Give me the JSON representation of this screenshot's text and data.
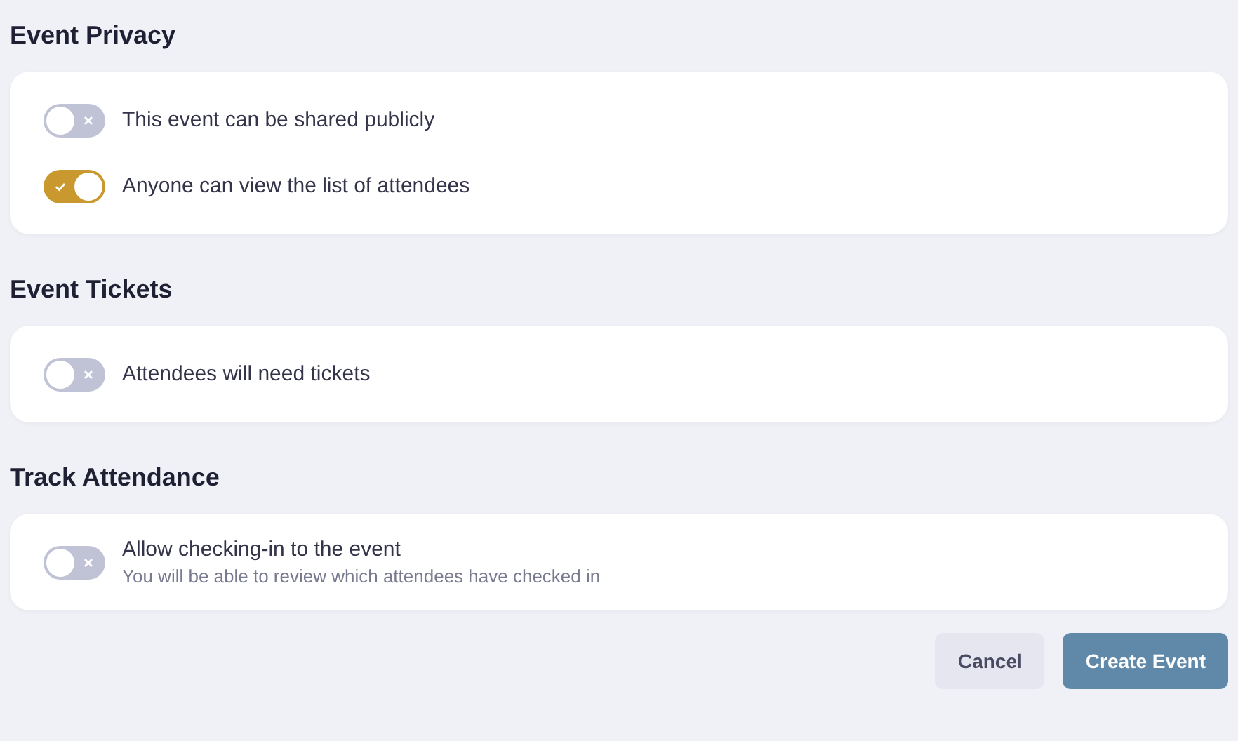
{
  "sections": [
    {
      "title": "Event Privacy",
      "options": [
        {
          "label": "This event can be shared publicly",
          "on": false
        },
        {
          "label": "Anyone can view the list of attendees",
          "on": true
        }
      ]
    },
    {
      "title": "Event Tickets",
      "options": [
        {
          "label": "Attendees will need tickets",
          "on": false
        }
      ]
    },
    {
      "title": "Track Attendance",
      "options": [
        {
          "label": "Allow checking-in to the event",
          "description": "You will be able to review which attendees have checked in",
          "on": false
        }
      ]
    }
  ],
  "buttons": [
    {
      "label": "Cancel",
      "kind": "secondary"
    },
    {
      "label": "Create Event",
      "kind": "primary"
    }
  ]
}
